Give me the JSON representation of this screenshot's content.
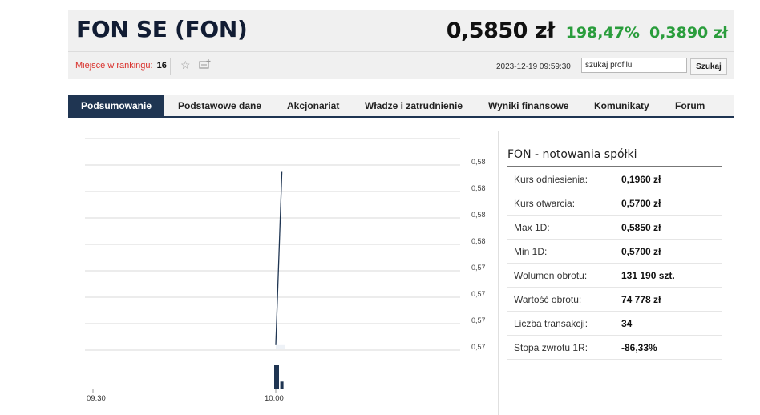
{
  "header": {
    "company": "FON SE (FON)",
    "price": "0,5850 zł",
    "change_pct": "198,47%",
    "change_abs": "0,3890 zł",
    "ranking_label": "Miejsce w rankingu:",
    "ranking_value": "16",
    "timestamp": "2023-12-19 09:59:30",
    "search_value": "szukaj profilu",
    "search_button": "Szukaj",
    "icons": [
      "star-icon",
      "add-to-portfolio-icon"
    ]
  },
  "colors": {
    "accent": "#1f3552",
    "positive": "#2a9d3c",
    "ranking_label": "#d9302b",
    "price_line": "#1f3552"
  },
  "tabs": [
    {
      "label": "Podsumowanie",
      "active": true
    },
    {
      "label": "Podstawowe dane",
      "active": false
    },
    {
      "label": "Akcjonariat",
      "active": false
    },
    {
      "label": "Władze i zatrudnienie",
      "active": false
    },
    {
      "label": "Wyniki finansowe",
      "active": false
    },
    {
      "label": "Komunikaty",
      "active": false
    },
    {
      "label": "Forum",
      "active": false
    }
  ],
  "chart_data": {
    "type": "line",
    "x_tick_labels": [
      "09:30",
      "10:00"
    ],
    "y_tick_labels": [
      "0,58",
      "0,58",
      "0,58",
      "0,58",
      "0,57",
      "0,57",
      "0,57",
      "0,57"
    ],
    "price_series": [
      {
        "time": "10:00",
        "price": 0.57
      },
      {
        "time": "10:01",
        "price": 0.585
      }
    ],
    "volume_series": [
      {
        "time": "10:00",
        "volume": 1.0
      },
      {
        "time": "10:01",
        "volume": 0.3
      }
    ],
    "grid": true
  },
  "info": {
    "title": "FON - notowania spółki",
    "rows": [
      {
        "label": "Kurs odniesienia:",
        "value": "0,1960 zł"
      },
      {
        "label": "Kurs otwarcia:",
        "value": "0,5700 zł"
      },
      {
        "label": "Max 1D:",
        "value": "0,5850 zł"
      },
      {
        "label": "Min 1D:",
        "value": "0,5700 zł"
      },
      {
        "label": "Wolumen obrotu:",
        "value": "131 190 szt."
      },
      {
        "label": "Wartość obrotu:",
        "value": "74 778 zł"
      },
      {
        "label": "Liczba transakcji:",
        "value": "34"
      },
      {
        "label": "Stopa zwrotu 1R:",
        "value": "-86,33%"
      }
    ]
  }
}
